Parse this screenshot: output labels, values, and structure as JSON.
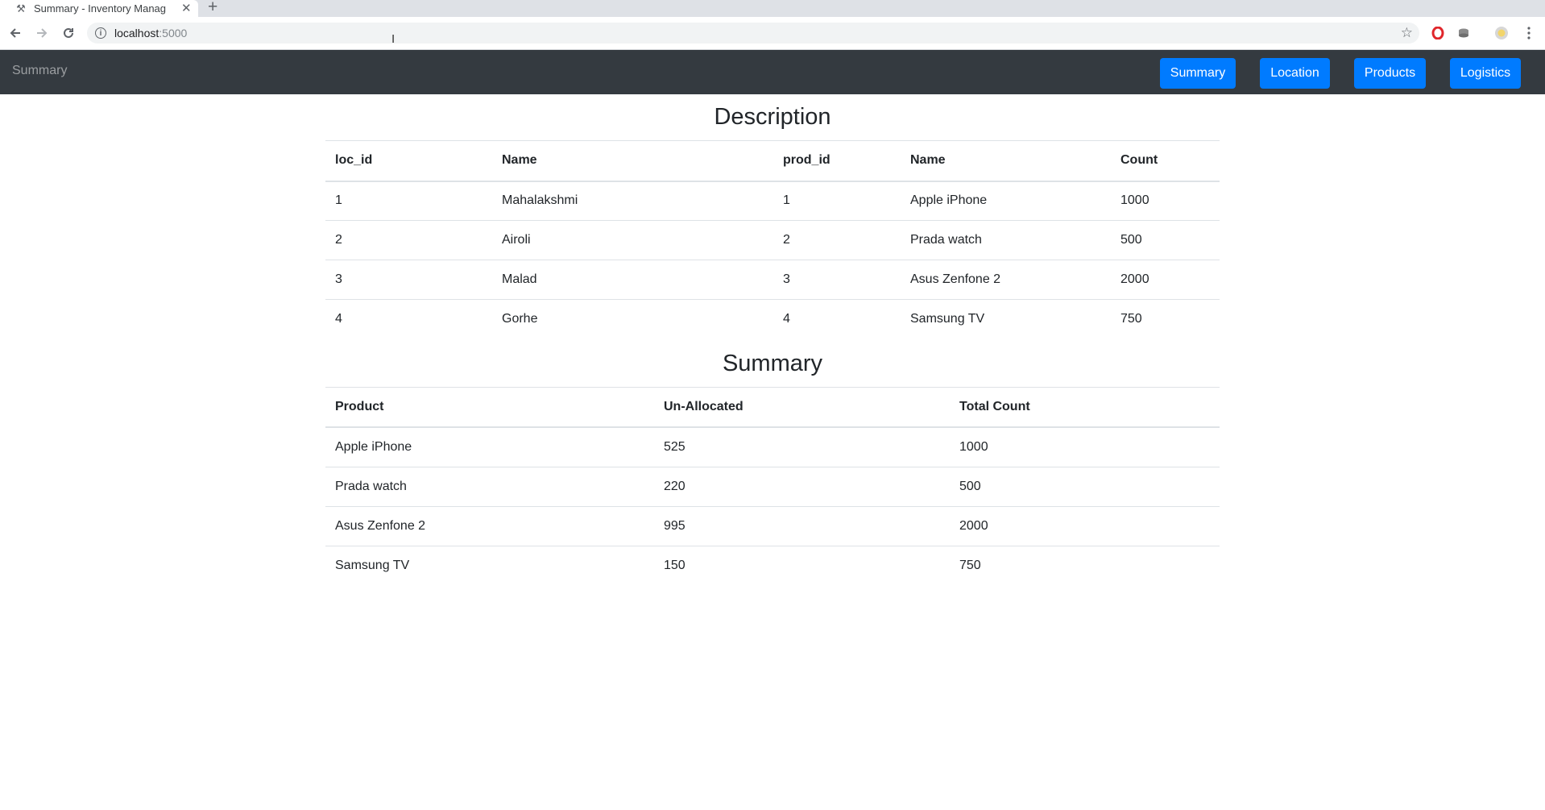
{
  "browser": {
    "tab_title": "Summary - Inventory Manag",
    "new_tab_symbol": "+",
    "url_host": "localhost",
    "url_port": ":5000"
  },
  "navbar": {
    "brand": "Summary",
    "buttons": [
      {
        "label": "Summary"
      },
      {
        "label": "Location"
      },
      {
        "label": "Products"
      },
      {
        "label": "Logistics"
      }
    ]
  },
  "description": {
    "title": "Description",
    "headers": [
      "loc_id",
      "Name",
      "prod_id",
      "Name",
      "Count"
    ],
    "rows": [
      [
        "1",
        "Mahalakshmi",
        "1",
        "Apple iPhone",
        "1000"
      ],
      [
        "2",
        "Airoli",
        "2",
        "Prada watch",
        "500"
      ],
      [
        "3",
        "Malad",
        "3",
        "Asus Zenfone 2",
        "2000"
      ],
      [
        "4",
        "Gorhe",
        "4",
        "Samsung TV",
        "750"
      ]
    ]
  },
  "summary": {
    "title": "Summary",
    "headers": [
      "Product",
      "Un-Allocated",
      "Total Count"
    ],
    "rows": [
      [
        "Apple iPhone",
        "525",
        "1000"
      ],
      [
        "Prada watch",
        "220",
        "500"
      ],
      [
        "Asus Zenfone 2",
        "995",
        "2000"
      ],
      [
        "Samsung TV",
        "150",
        "750"
      ]
    ]
  },
  "colors": {
    "navbar_bg": "#343a40",
    "button_bg": "#007bff"
  }
}
